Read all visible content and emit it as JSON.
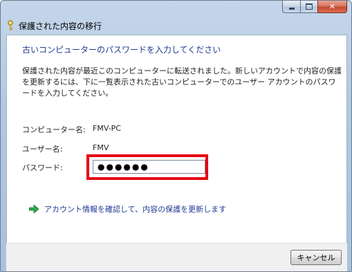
{
  "window": {
    "title": "保護された内容の移行"
  },
  "page": {
    "heading": "古いコンピューターのパスワードを入力してください",
    "description": "保護された内容が最近このコンピューターに転送されました。新しいアカウントで内容の保護を更新するには、下に一覧表示された古いコンピューターでのユーザー アカウントのパスワードを入力してください。"
  },
  "fields": {
    "computer_name_label": "コンピューター名:",
    "computer_name_value": "FMV-PC",
    "user_name_label": "ユーザー名:",
    "user_name_value": "FMV",
    "password_label": "パスワード:",
    "password_value": "●●●●●●"
  },
  "command_link": {
    "label": "アカウント情報を確認して、内容の保護を更新します",
    "icon": "green-arrow-icon"
  },
  "footer": {
    "cancel_label": "キャンセル"
  },
  "colors": {
    "heading": "#1f3a93",
    "highlight_border": "#e60012",
    "link": "#1f3a93"
  }
}
